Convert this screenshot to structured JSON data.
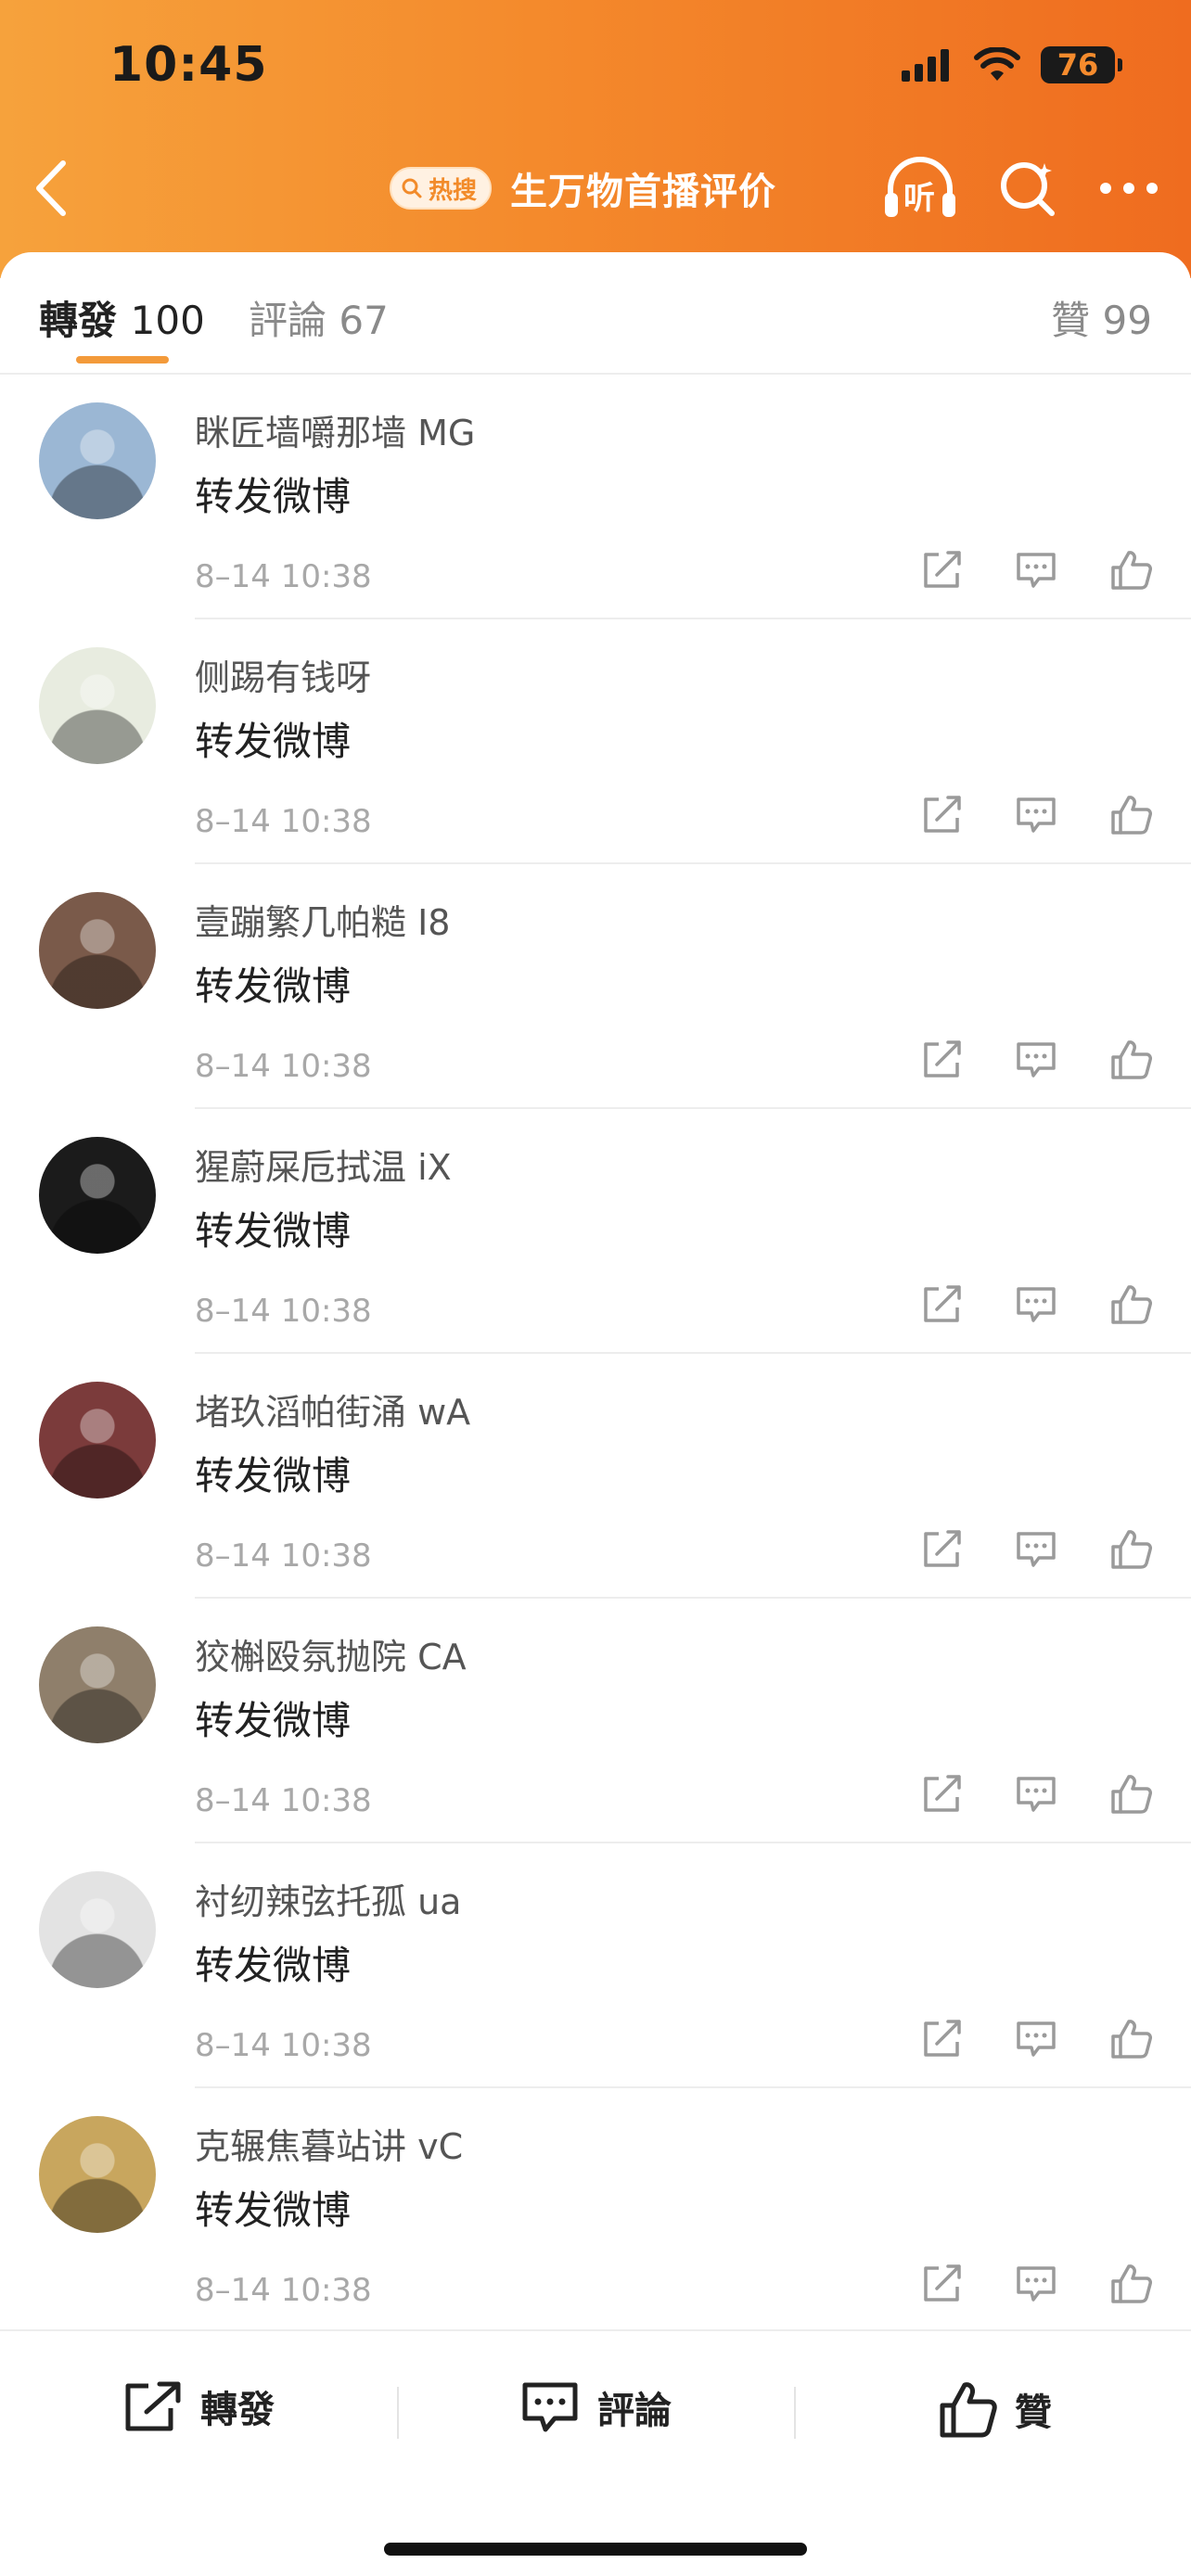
{
  "status_bar": {
    "time": "10:45",
    "battery": "76"
  },
  "nav": {
    "hot_badge": "热搜",
    "title": "生万物首播评价",
    "listen_label": "听"
  },
  "tabs": [
    {
      "label": "轉發",
      "count": "100"
    },
    {
      "label": "評論",
      "count": "67"
    },
    {
      "label": "贊",
      "count": "99"
    }
  ],
  "reposts": [
    {
      "name": "眯匠墙嚼那墙 MG",
      "content": "转发微博",
      "time": "8–14 10:38",
      "avatar_color": "#9bb7d4"
    },
    {
      "name": "侧踢有钱呀",
      "content": "转发微博",
      "time": "8–14 10:38",
      "avatar_color": "#e8ece0"
    },
    {
      "name": "壹蹦繁几帕糙 I8",
      "content": "转发微博",
      "time": "8–14 10:38",
      "avatar_color": "#7a5a4a"
    },
    {
      "name": "猩蔚屎卮拭温 iX",
      "content": "转发微博",
      "time": "8–14 10:38",
      "avatar_color": "#1b1b1b"
    },
    {
      "name": "堵玖滔帕街涌 wA",
      "content": "转发微博",
      "time": "8–14 10:38",
      "avatar_color": "#7b3b3b"
    },
    {
      "name": "狡槲殴氛抛院 CA",
      "content": "转发微博",
      "time": "8–14 10:38",
      "avatar_color": "#8f7f6b"
    },
    {
      "name": "衬纫辣弦托孤 ua",
      "content": "转发微博",
      "time": "8–14 10:38",
      "avatar_color": "#e3e3e3"
    },
    {
      "name": "克辗焦暮站讲 vC",
      "content": "转发微博",
      "time": "8–14 10:38",
      "avatar_color": "#c8a65e"
    }
  ],
  "bottom_bar": {
    "repost": "轉發",
    "comment": "評論",
    "like": "贊"
  },
  "colors": {
    "accent": "#f39a3a",
    "header_start": "#f6a23c",
    "header_end": "#ef6c1f"
  }
}
